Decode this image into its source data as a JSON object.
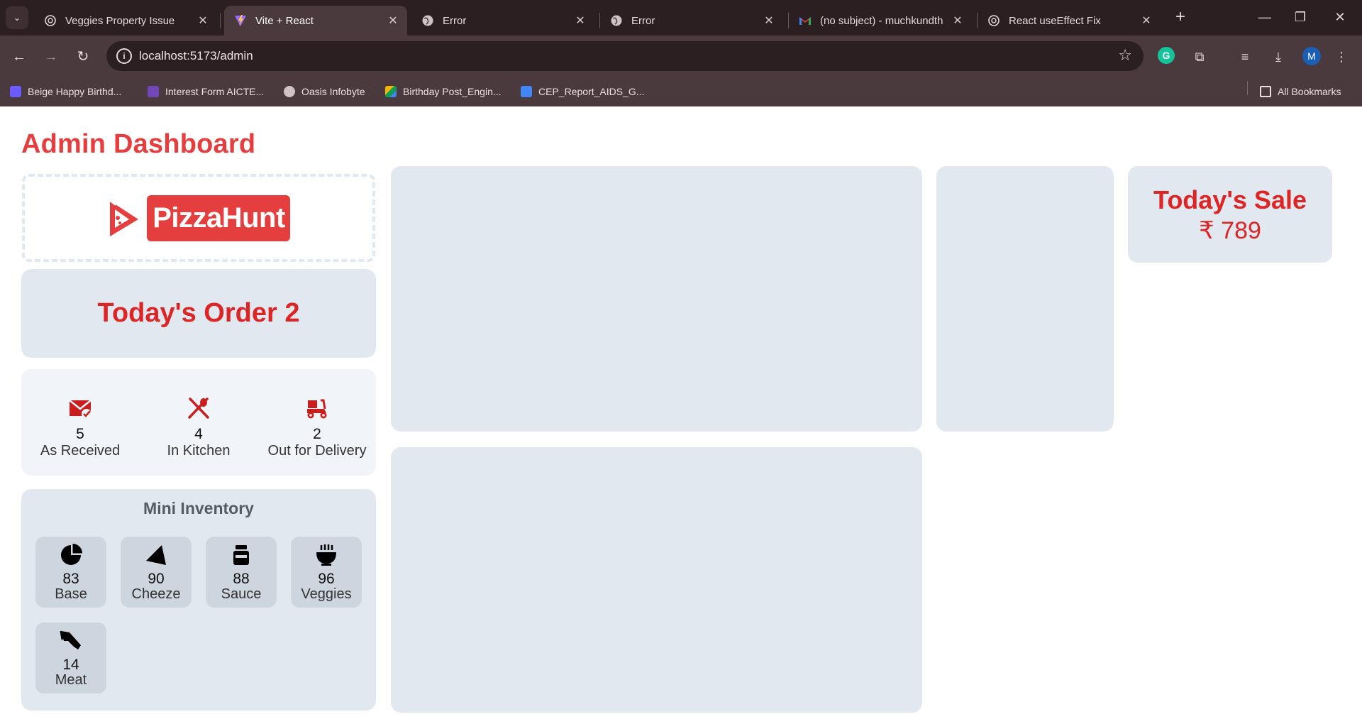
{
  "browser": {
    "tabs": [
      {
        "title": "Veggies Property Issue",
        "active": false,
        "icon": "openai-icon"
      },
      {
        "title": "Vite + React",
        "active": true,
        "icon": "vite-icon"
      },
      {
        "title": "Error",
        "active": false,
        "icon": "globe-icon"
      },
      {
        "title": "Error",
        "active": false,
        "icon": "globe-icon"
      },
      {
        "title": "(no subject) - muchkundth",
        "active": false,
        "icon": "gmail-icon"
      },
      {
        "title": "React useEffect Fix",
        "active": false,
        "icon": "openai-icon"
      }
    ],
    "url": "localhost:5173/admin",
    "bookmarks": [
      {
        "label": "Beige Happy Birthd...",
        "icon": "heart-shield-icon",
        "color": "#6a5cff"
      },
      {
        "label": "Interest Form AICTE...",
        "icon": "forms-icon",
        "color": "#7248b9"
      },
      {
        "label": "Oasis Infobyte",
        "icon": "globe-icon",
        "color": "#cfc3c5"
      },
      {
        "label": "Birthday Post_Engin...",
        "icon": "drive-icon",
        "color": "#f4b400"
      },
      {
        "label": "CEP_Report_AIDS_G...",
        "icon": "docs-icon",
        "color": "#4285f4"
      }
    ],
    "all_bookmarks": "All Bookmarks",
    "avatar_initial": "M"
  },
  "page": {
    "title": "Admin Dashboard",
    "logo_text": "PizzaHunt",
    "todays_order": "Today's Order 2",
    "status": [
      {
        "value": "5",
        "label": "As Received",
        "icon": "mail-check-icon"
      },
      {
        "value": "4",
        "label": "In Kitchen",
        "icon": "utensils-icon"
      },
      {
        "value": "2",
        "label": "Out for Delivery",
        "icon": "scooter-icon"
      }
    ],
    "inventory_title": "Mini Inventory",
    "inventory": [
      {
        "value": "83",
        "label": "Base",
        "icon": "pie-icon"
      },
      {
        "value": "90",
        "label": "Cheeze",
        "icon": "cheese-wedge-icon"
      },
      {
        "value": "88",
        "label": "Sauce",
        "icon": "jar-icon"
      },
      {
        "value": "96",
        "label": "Veggies",
        "icon": "bowl-icon"
      },
      {
        "value": "14",
        "label": "Meat",
        "icon": "drumstick-icon"
      }
    ],
    "sale_title": "Today's Sale",
    "sale_value": "₹ 789"
  },
  "colors": {
    "brand_red": "#e53e3e",
    "card_bg": "#e2e8f0"
  }
}
